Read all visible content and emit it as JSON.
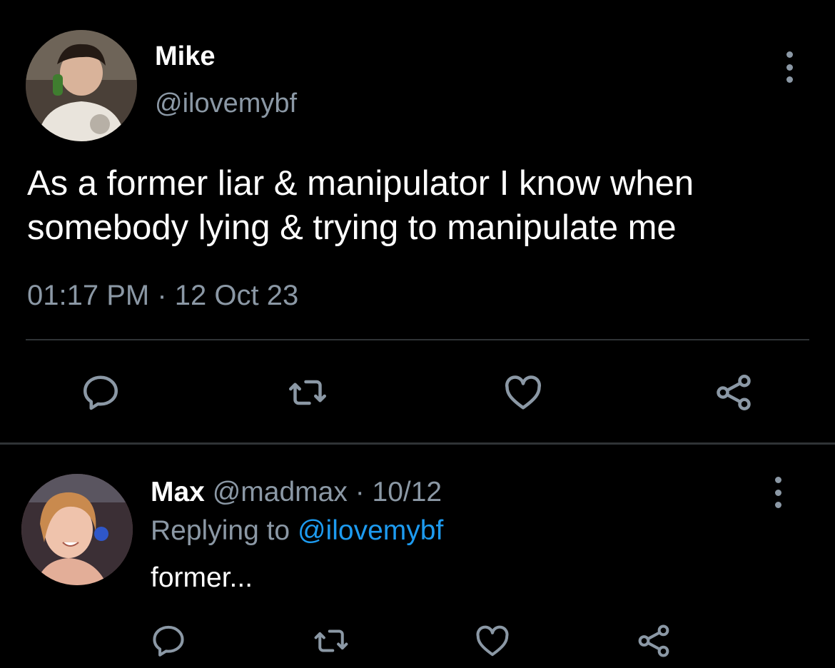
{
  "tweet": {
    "author": {
      "name": "Mike",
      "handle": "@ilovemybf"
    },
    "text": "As a former liar & manipulator I know when somebody lying & trying to manipulate me",
    "timestamp": "01:17 PM · 12 Oct 23",
    "more_icon": "more-vertical-icon",
    "actions": [
      "reply-icon",
      "retweet-icon",
      "like-icon",
      "share-icon"
    ]
  },
  "reply": {
    "author": {
      "name": "Max",
      "handle": "@madmax",
      "date": "· 10/12"
    },
    "replying_prefix": "Replying to",
    "replying_to": "@ilovemybf",
    "text": "former...",
    "more_icon": "more-vertical-icon",
    "actions": [
      "reply-icon",
      "retweet-icon",
      "like-icon",
      "share-icon"
    ]
  },
  "colors": {
    "background": "#000000",
    "text_primary": "#ffffff",
    "text_secondary": "#8b98a5",
    "link": "#1d9bf0",
    "divider": "#2f3336"
  }
}
